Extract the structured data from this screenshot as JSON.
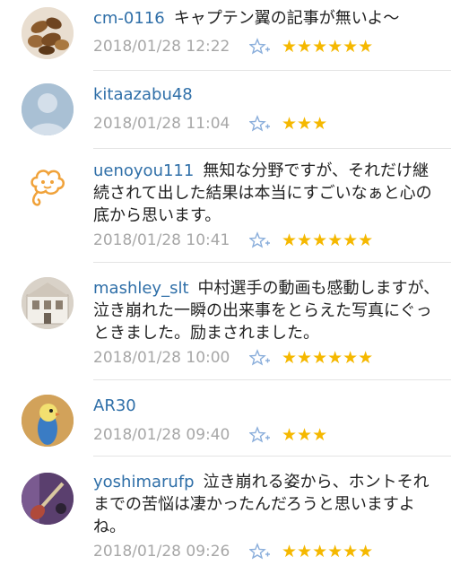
{
  "comments": [
    {
      "user": "cm-0116",
      "text": "キャプテン翼の記事が無いよ〜",
      "date": "2018/01/28 12:22",
      "stars": "★★★★★★",
      "avatar": "nuts-avatar"
    },
    {
      "user": "kitaazabu48",
      "text": "",
      "date": "2018/01/28 11:04",
      "stars": "★★★",
      "avatar": "default-user-avatar"
    },
    {
      "user": "uenoyou111",
      "text": "無知な分野ですが、それだけ継続されて出した結果は本当にすごいなぁと心の底から思います。",
      "date": "2018/01/28 10:41",
      "stars": "★★★★★★",
      "avatar": "cloud-character-avatar"
    },
    {
      "user": "mashley_slt",
      "text": "中村選手の動画も感動しますが、泣き崩れた一瞬の出来事をとらえた写真にぐっときました。励まされました。",
      "date": "2018/01/28 10:00",
      "stars": "★★★★★★",
      "avatar": "dollhouse-avatar"
    },
    {
      "user": "AR30",
      "text": "",
      "date": "2018/01/28 09:40",
      "stars": "★★★",
      "avatar": "bird-avatar"
    },
    {
      "user": "yoshimarufp",
      "text": "泣き崩れる姿から、ホントそれまでの苦悩は凄かったんだろうと思いますよね。",
      "date": "2018/01/28 09:26",
      "stars": "★★★★★★",
      "avatar": "guitar-avatar"
    }
  ]
}
